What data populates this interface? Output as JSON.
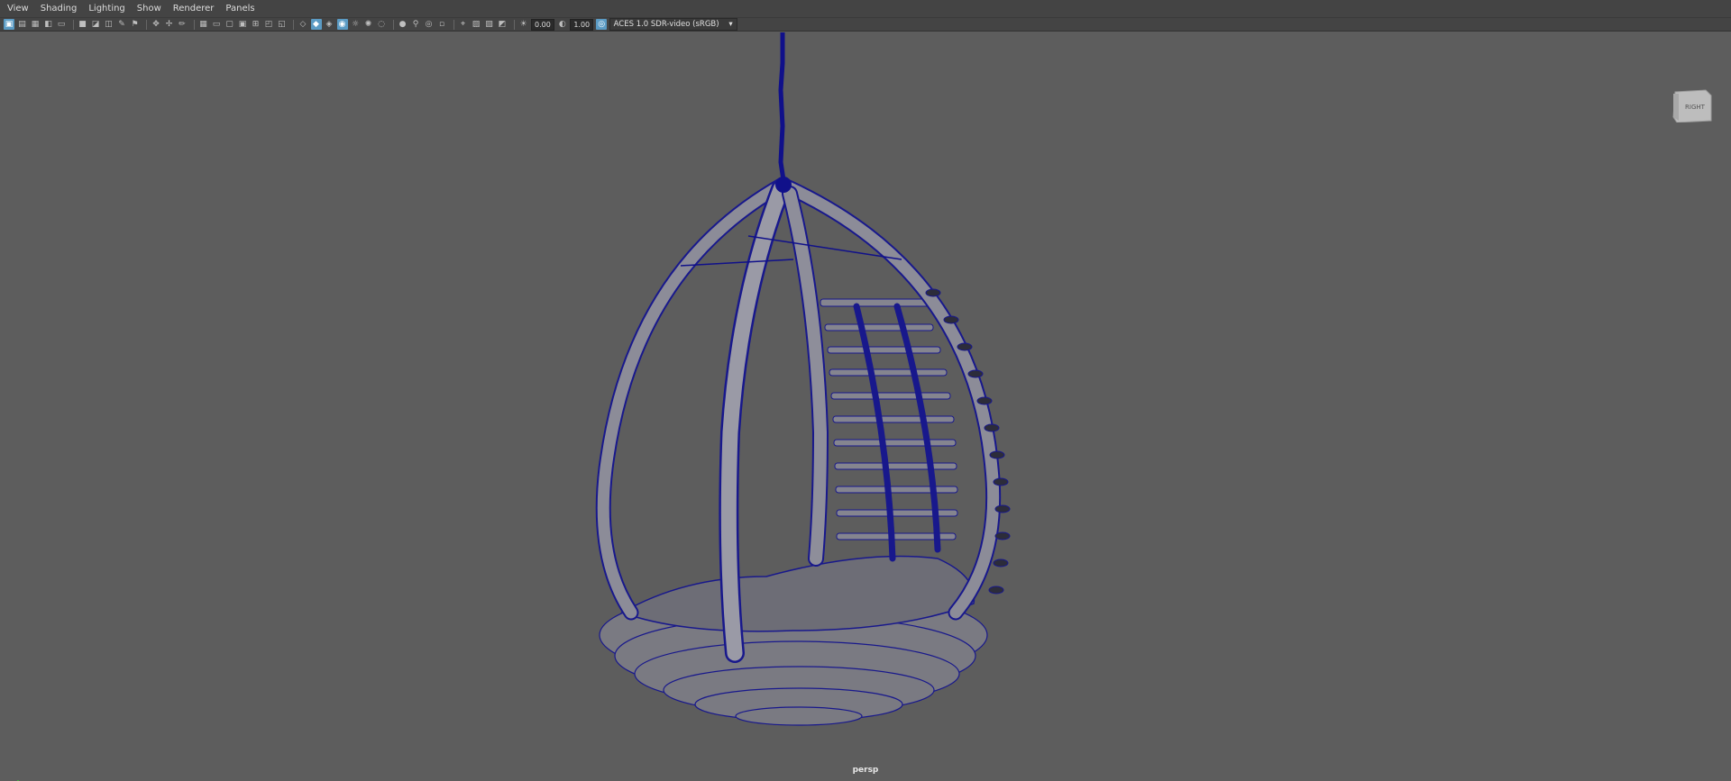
{
  "menu": [
    "View",
    "Shading",
    "Lighting",
    "Show",
    "Renderer",
    "Panels"
  ],
  "toolbar": {
    "exposure": "0.00",
    "gamma": "1.00",
    "color_space": "ACES 1.0 SDR-video (sRGB)"
  },
  "viewport": {
    "camera": "persp",
    "view_cube_label": "RIGHT"
  },
  "colors": {
    "background": "#5d5d5d",
    "wireframe": "#1a1aa0",
    "active_button": "#5b9bc4"
  }
}
